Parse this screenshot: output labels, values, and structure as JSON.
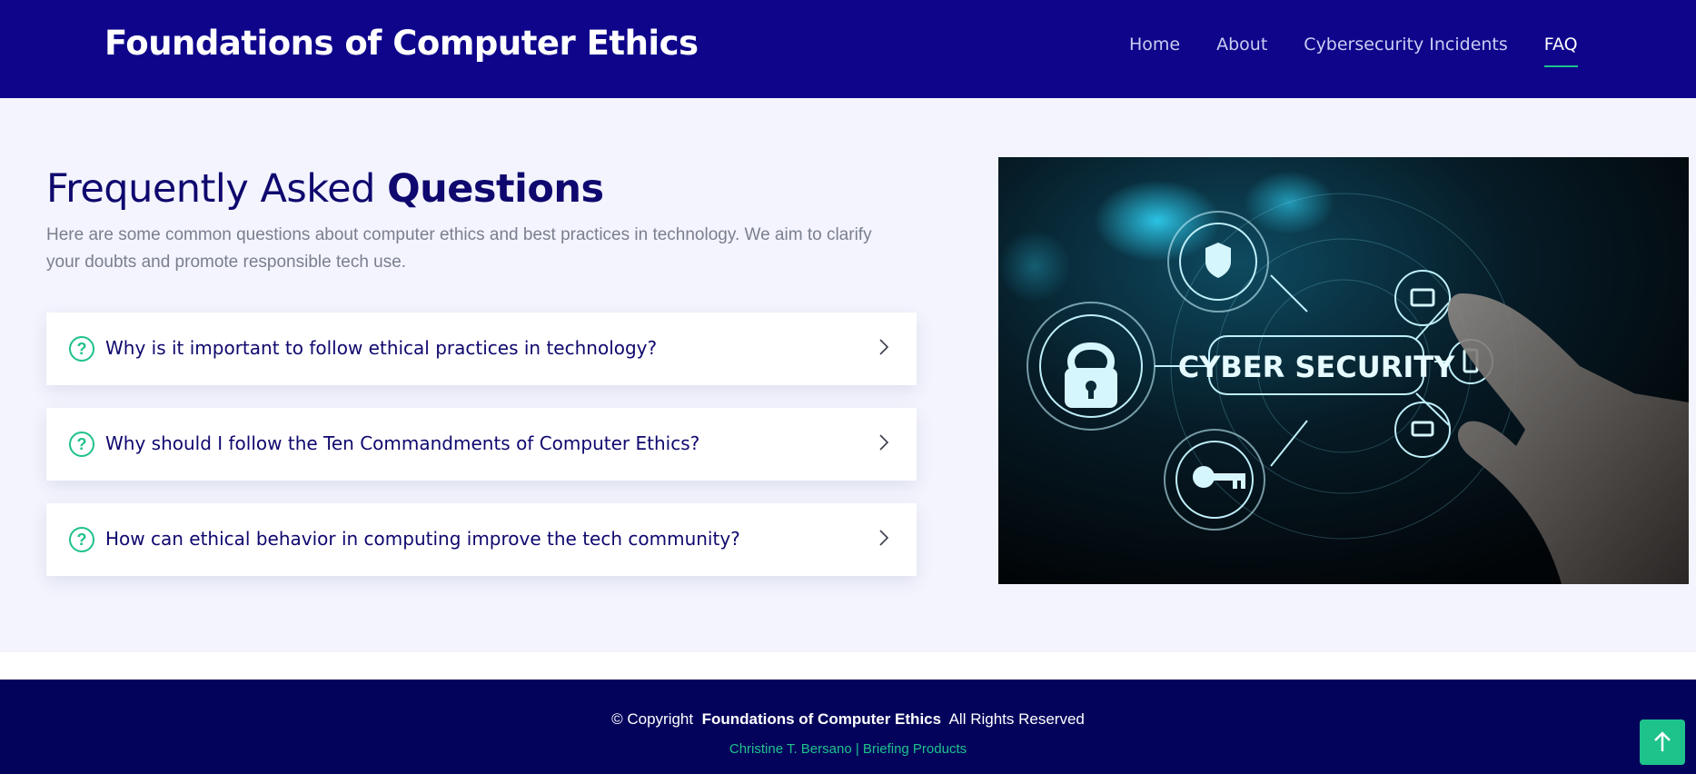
{
  "header": {
    "brand": "Foundations of Computer Ethics",
    "nav": [
      "Home",
      "About",
      "Cybersecurity Incidents",
      "FAQ"
    ],
    "active_nav": "FAQ"
  },
  "faq_section": {
    "title_regular": "Frequently Asked",
    "title_bold": "Questions",
    "intro": "Here are some common questions about computer ethics and best practices in technology. We aim to clarify your doubts and promote responsible tech use.",
    "questions": [
      "Why is it important to follow ethical practices in technology?",
      "Why should I follow the Ten Commandments of Computer Ethics?",
      "How can ethical behavior in computing improve the tech community?"
    ],
    "question_icon": "question-circle-icon",
    "expand_icon": "chevron-right-icon"
  },
  "hero_image": {
    "label": "CYBER SECURITY",
    "icons": [
      "lock-icon",
      "database-shield-icon",
      "key-icon",
      "monitor-icon",
      "phone-icon",
      "laptop-icon"
    ]
  },
  "footer": {
    "copyright_prefix": "© Copyright",
    "copyright_name": "Foundations of Computer Ethics",
    "copyright_suffix": "All Rights Reserved",
    "credits": "Christine T. Bersano | Briefing Products"
  },
  "back_to_top_icon": "arrow-up-icon",
  "colors": {
    "header_bg": "#0f058b",
    "accent": "#1ec28b",
    "title": "#0f086e",
    "footer_bg": "#04035c",
    "section_bg": "#f3f4fd"
  }
}
